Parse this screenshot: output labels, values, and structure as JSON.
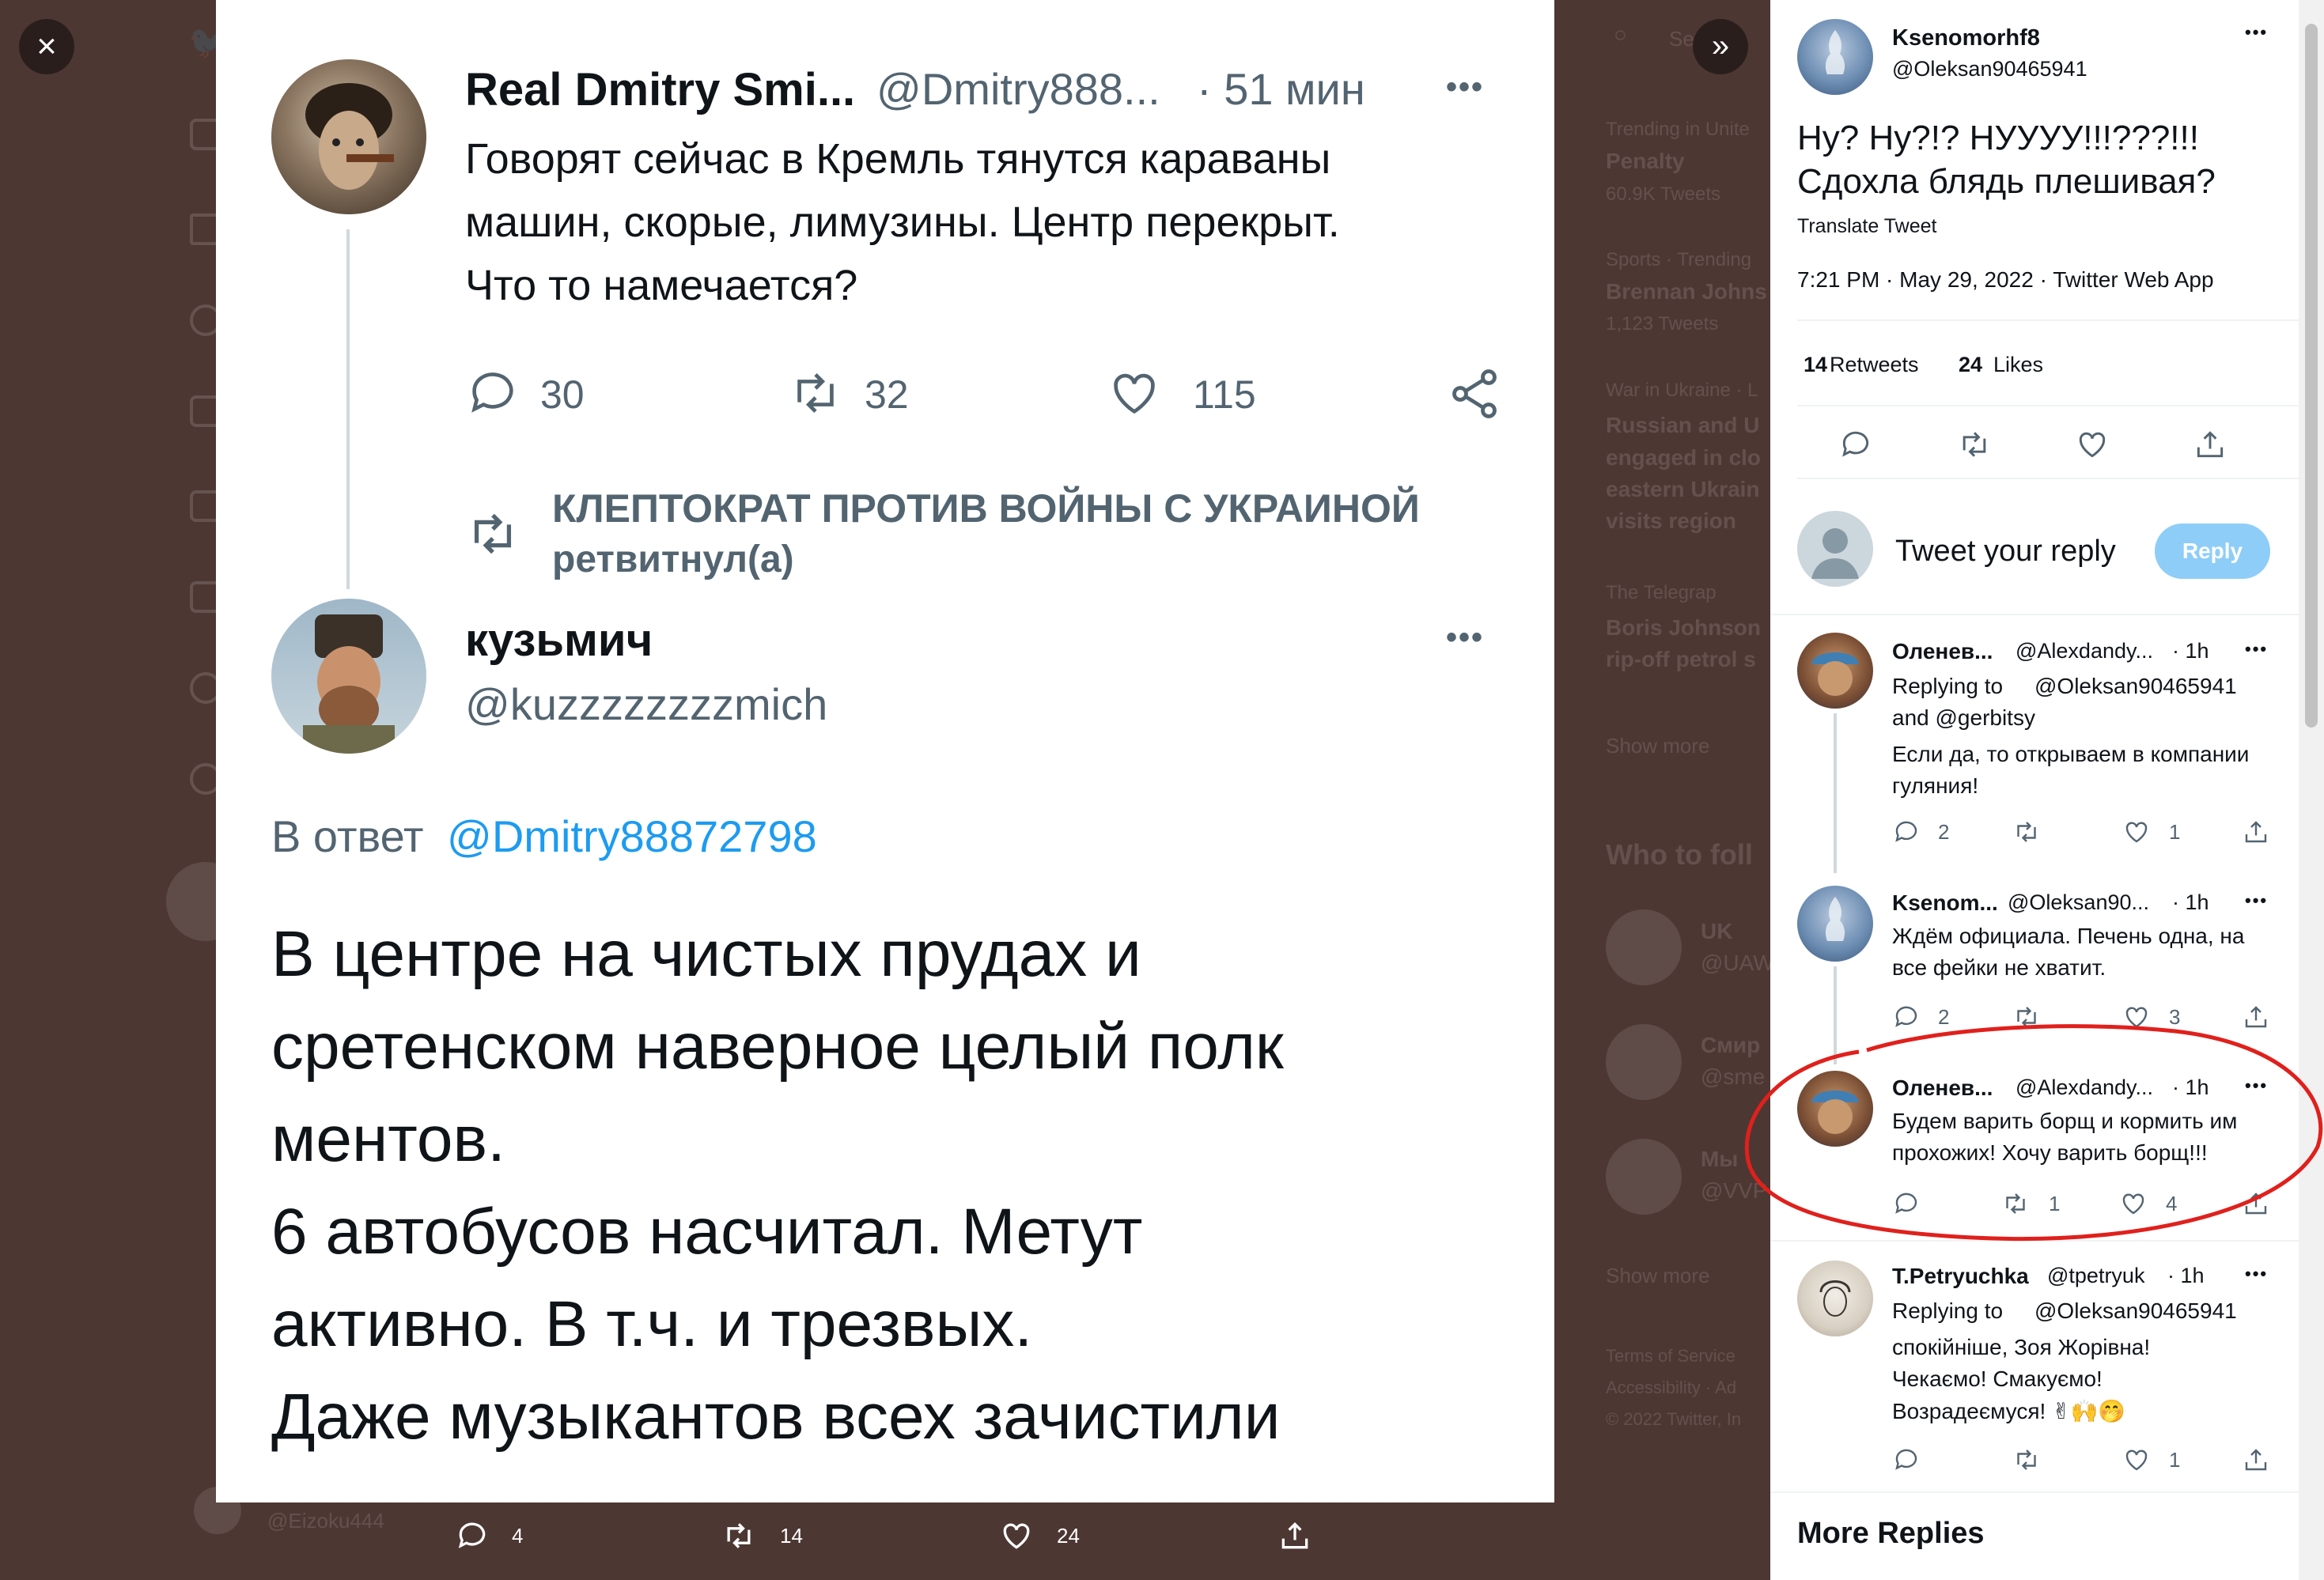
{
  "controls": {
    "close": "×",
    "expand": "»"
  },
  "backdrop": {
    "search_placeholder": "Se",
    "trends": [
      {
        "meta": "Trending in Unite",
        "name": "Penalty",
        "count": "60.9K Tweets"
      },
      {
        "meta": "Sports · Trending",
        "name": "Brennan Johns",
        "count": "1,123 Tweets"
      },
      {
        "meta": "War in Ukraine · L",
        "name": "Russian and U",
        "line2": "engaged in clo",
        "line3": "eastern Ukrain",
        "line4": "visits region"
      },
      {
        "meta": "The Telegrap",
        "name": "Boris Johnson",
        "line2": "rip-off petrol s"
      }
    ],
    "show_more": "Show more",
    "who_to_follow": "Who to foll",
    "follow_items": [
      {
        "name": "UK",
        "handle": "@UAW"
      },
      {
        "name": "Смир",
        "handle": "@sme"
      },
      {
        "name": "Мы",
        "handle": "@VVP"
      }
    ],
    "show_more2": "Show more",
    "footer": [
      "Terms of Service",
      "Accessibility · Ad",
      "© 2022 Twitter, In"
    ],
    "bottom_handle": "@Eizoku444"
  },
  "image": {
    "tweet1": {
      "name": "Real Dmitry Smi...",
      "handle": "@Dmitry888...",
      "time": "· 51 мин",
      "more": "•••",
      "text_lines": [
        "Говорят сейчас в Кремль тянутся караваны",
        "машин, скорые, лимузины. Центр перекрыт.",
        "Что то намечается?"
      ],
      "replies": "30",
      "retweets": "32",
      "likes": "115"
    },
    "retweet_banner": {
      "line1": "КЛЕПТОКРАТ ПРОТИВ ВОЙНЫ С УКРАИНОЙ",
      "line2": "ретвитнул(а)"
    },
    "tweet2": {
      "name": "кузьмич",
      "handle": "@kuzzzzzzzzmich",
      "more": "•••",
      "reply_prefix": "В ответ",
      "reply_to": "@Dmitry88872798",
      "text_lines": [
        "В центре на чистых прудах и",
        "сретенском наверное целый полк",
        "ментов.",
        "6 автобусов насчитал. Метут",
        "активно. В т.ч. и трезвых.",
        "Даже музыкантов всех зачистили"
      ]
    }
  },
  "media_actions": {
    "replies": "4",
    "retweets": "14",
    "likes": "24"
  },
  "panel": {
    "main": {
      "name": "Ksenomorhf8",
      "handle": "@Oleksan90465941",
      "more": "•••",
      "text_lines": [
        "Ну? Ну?!? НУУУУ!!!???!!!",
        "Сдохла блядь плешивая?"
      ],
      "translate": "Translate Tweet",
      "meta": "7:21 PM · May 29, 2022 · Twitter Web App",
      "retweets_count": "14",
      "retweets_label": "Retweets",
      "likes_count": "24",
      "likes_label": "Likes"
    },
    "compose": {
      "placeholder": "Tweet your reply",
      "button": "Reply"
    },
    "replies": [
      {
        "name": "Оленев...",
        "handle": "@Alexdandy...",
        "time": "· 1h",
        "replying_label": "Replying to",
        "replying_to": "@Oleksan90465941",
        "replying_and": "and @gerbitsy",
        "text_lines": [
          "Если да, то открываем в компании",
          "гуляния!"
        ],
        "replies": "2",
        "retweets": "",
        "likes": "1"
      },
      {
        "name": "Ksenom...",
        "handle": "@Oleksan90...",
        "time": "· 1h",
        "text_lines": [
          "Ждём официала. Печень одна, на",
          "все фейки не хватит."
        ],
        "replies": "2",
        "retweets": "",
        "likes": "3"
      },
      {
        "name": "Оленев...",
        "handle": "@Alexdandy...",
        "time": "· 1h",
        "text_lines": [
          "Будем варить борщ и кормить им",
          "прохожих! Хочу варить борщ!!!"
        ],
        "replies": "",
        "retweets": "1",
        "likes": "4"
      },
      {
        "name": "T.Petryuchka",
        "handle": "@tpetryuk",
        "time": "· 1h",
        "replying_label": "Replying to",
        "replying_to": "@Oleksan90465941",
        "text_lines": [
          "спокійніше, Зоя Жорівна!",
          "Чекаємо! Смакуємо!",
          "Возрадеємуся! ✌🙌🤭"
        ],
        "replies": "",
        "retweets": "",
        "likes": "1"
      }
    ],
    "more_replies": "More Replies"
  }
}
